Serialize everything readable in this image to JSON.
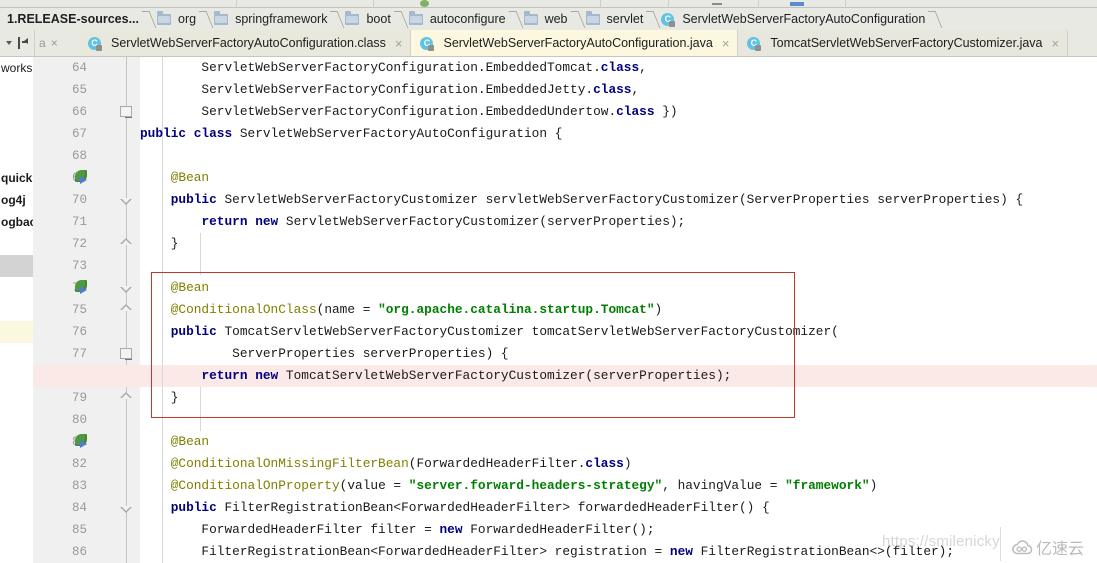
{
  "window": {
    "ide": "IntelliJ IDEA",
    "breadcrumb_separator": "›"
  },
  "breadcrumb": {
    "items": [
      {
        "label": "1.RELEASE-sources...",
        "icon": "",
        "bold": true
      },
      {
        "label": "org",
        "icon": "folder-icon",
        "bold": false
      },
      {
        "label": "springframework",
        "icon": "folder-icon",
        "bold": false
      },
      {
        "label": "boot",
        "icon": "folder-icon",
        "bold": false
      },
      {
        "label": "autoconfigure",
        "icon": "folder-icon",
        "bold": false
      },
      {
        "label": "web",
        "icon": "folder-icon",
        "bold": false
      },
      {
        "label": "servlet",
        "icon": "folder-icon",
        "bold": false
      },
      {
        "label": "ServletWebServerFactoryAutoConfiguration",
        "icon": "java-class-icon",
        "bold": false
      }
    ]
  },
  "tab_bar": {
    "nav_icons": [
      "chevron-down-icon",
      "split-editor-icon"
    ],
    "clipped_tab_label": "a",
    "tabs": [
      {
        "label": "ServletWebServerFactoryAutoConfiguration.class",
        "icon": "java-class-icon",
        "state": "selected",
        "close": "×"
      },
      {
        "label": "ServletWebServerFactoryAutoConfiguration.java",
        "icon": "java-class-icon",
        "state": "active",
        "close": "×"
      },
      {
        "label": "TomcatServletWebServerFactoryCustomizer.java",
        "icon": "java-class-icon",
        "state": "inactive",
        "close": "×"
      }
    ],
    "close_glyph": "×"
  },
  "left_panel": {
    "rows": [
      {
        "text": "worksp",
        "bold": false,
        "state": "normal"
      },
      {
        "text": "",
        "bold": false,
        "state": "normal"
      },
      {
        "text": "",
        "bold": false,
        "state": "normal"
      },
      {
        "text": "",
        "bold": false,
        "state": "normal"
      },
      {
        "text": "",
        "bold": false,
        "state": "normal"
      },
      {
        "text": "quick",
        "bold": true,
        "state": "normal"
      },
      {
        "text": "og4j",
        "bold": true,
        "state": "normal"
      },
      {
        "text": "ogbac",
        "bold": true,
        "state": "normal"
      },
      {
        "text": "",
        "bold": false,
        "state": "normal"
      },
      {
        "text": "",
        "bold": false,
        "state": "selected"
      },
      {
        "text": "",
        "bold": false,
        "state": "normal"
      },
      {
        "text": "",
        "bold": false,
        "state": "normal"
      },
      {
        "text": "",
        "bold": false,
        "state": "highlight"
      }
    ]
  },
  "editor": {
    "first_line": 64,
    "gutter_markers": [
      {
        "line": 69,
        "icon": "spring-bean-icon"
      },
      {
        "line": 74,
        "icon": "spring-bean-icon"
      },
      {
        "line": 78,
        "icon": "disabled-breakpoint-icon"
      },
      {
        "line": 81,
        "icon": "spring-bean-icon"
      }
    ],
    "highlight": {
      "block_border_color": "#c0392b",
      "executed_line_color": "#fbe9e7",
      "highlighted_line": 78,
      "block_start_line": 73,
      "block_end_line": 79
    },
    "lines": [
      {
        "n": 64,
        "indent": 0,
        "tokens": [
          {
            "t": "        ServletWebServerFactoryConfiguration.EmbeddedTomcat.",
            "c": "plain"
          },
          {
            "t": "class",
            "c": "kw"
          },
          {
            "t": ",",
            "c": "plain"
          }
        ]
      },
      {
        "n": 65,
        "indent": 0,
        "tokens": [
          {
            "t": "        ServletWebServerFactoryConfiguration.EmbeddedJetty.",
            "c": "plain"
          },
          {
            "t": "class",
            "c": "kw"
          },
          {
            "t": ",",
            "c": "plain"
          }
        ]
      },
      {
        "n": 66,
        "indent": 0,
        "tokens": [
          {
            "t": "        ServletWebServerFactoryConfiguration.EmbeddedUndertow.",
            "c": "plain"
          },
          {
            "t": "class",
            "c": "kw"
          },
          {
            "t": " })",
            "c": "plain"
          }
        ]
      },
      {
        "n": 67,
        "indent": 0,
        "tokens": [
          {
            "t": "public class",
            "c": "kw"
          },
          {
            "t": " ServletWebServerFactoryAutoConfiguration {",
            "c": "plain"
          }
        ]
      },
      {
        "n": 68,
        "indent": 0,
        "tokens": []
      },
      {
        "n": 69,
        "indent": 0,
        "tokens": [
          {
            "t": "    @Bean",
            "c": "ann"
          }
        ]
      },
      {
        "n": 70,
        "indent": 0,
        "tokens": [
          {
            "t": "    ",
            "c": "plain"
          },
          {
            "t": "public",
            "c": "kw"
          },
          {
            "t": " ServletWebServerFactoryCustomizer servletWebServerFactoryCustomizer(ServerProperties serverProperties) {",
            "c": "plain"
          }
        ]
      },
      {
        "n": 71,
        "indent": 0,
        "tokens": [
          {
            "t": "        ",
            "c": "plain"
          },
          {
            "t": "return new",
            "c": "kw"
          },
          {
            "t": " ServletWebServerFactoryCustomizer(serverProperties);",
            "c": "plain"
          }
        ]
      },
      {
        "n": 72,
        "indent": 0,
        "tokens": [
          {
            "t": "    }",
            "c": "plain"
          }
        ]
      },
      {
        "n": 73,
        "indent": 0,
        "tokens": []
      },
      {
        "n": 74,
        "indent": 0,
        "tokens": [
          {
            "t": "    @Bean",
            "c": "ann"
          }
        ]
      },
      {
        "n": 75,
        "indent": 0,
        "tokens": [
          {
            "t": "    @ConditionalOnClass",
            "c": "ann"
          },
          {
            "t": "(name = ",
            "c": "plain"
          },
          {
            "t": "\"org.apache.catalina.startup.Tomcat\"",
            "c": "str"
          },
          {
            "t": ")",
            "c": "plain"
          }
        ]
      },
      {
        "n": 76,
        "indent": 0,
        "tokens": [
          {
            "t": "    ",
            "c": "plain"
          },
          {
            "t": "public",
            "c": "kw"
          },
          {
            "t": " TomcatServletWebServerFactoryCustomizer tomcatServletWebServerFactoryCustomizer(",
            "c": "plain"
          }
        ]
      },
      {
        "n": 77,
        "indent": 0,
        "tokens": [
          {
            "t": "            ServerProperties serverProperties) {",
            "c": "plain"
          }
        ]
      },
      {
        "n": 78,
        "indent": 0,
        "tokens": [
          {
            "t": "        ",
            "c": "plain"
          },
          {
            "t": "return new",
            "c": "kw"
          },
          {
            "t": " TomcatServletWebServerFactoryCustomizer(serverProperties);",
            "c": "plain"
          }
        ]
      },
      {
        "n": 79,
        "indent": 0,
        "tokens": [
          {
            "t": "    }",
            "c": "plain"
          }
        ]
      },
      {
        "n": 80,
        "indent": 0,
        "tokens": []
      },
      {
        "n": 81,
        "indent": 0,
        "tokens": [
          {
            "t": "    @Bean",
            "c": "ann"
          }
        ]
      },
      {
        "n": 82,
        "indent": 0,
        "tokens": [
          {
            "t": "    @ConditionalOnMissingFilterBean",
            "c": "ann"
          },
          {
            "t": "(ForwardedHeaderFilter.",
            "c": "plain"
          },
          {
            "t": "class",
            "c": "kw"
          },
          {
            "t": ")",
            "c": "plain"
          }
        ]
      },
      {
        "n": 83,
        "indent": 0,
        "tokens": [
          {
            "t": "    @ConditionalOnProperty",
            "c": "ann"
          },
          {
            "t": "(value = ",
            "c": "plain"
          },
          {
            "t": "\"server.forward-headers-strategy\"",
            "c": "str"
          },
          {
            "t": ", havingValue = ",
            "c": "plain"
          },
          {
            "t": "\"framework\"",
            "c": "str"
          },
          {
            "t": ")",
            "c": "plain"
          }
        ]
      },
      {
        "n": 84,
        "indent": 0,
        "tokens": [
          {
            "t": "    ",
            "c": "plain"
          },
          {
            "t": "public",
            "c": "kw"
          },
          {
            "t": " FilterRegistrationBean<ForwardedHeaderFilter> forwardedHeaderFilter() {",
            "c": "plain"
          }
        ]
      },
      {
        "n": 85,
        "indent": 0,
        "tokens": [
          {
            "t": "        ForwardedHeaderFilter filter = ",
            "c": "plain"
          },
          {
            "t": "new",
            "c": "kw"
          },
          {
            "t": " ForwardedHeaderFilter();",
            "c": "plain"
          }
        ]
      },
      {
        "n": 86,
        "indent": 0,
        "tokens": [
          {
            "t": "        FilterRegistrationBean<ForwardedHeaderFilter> registration = ",
            "c": "plain"
          },
          {
            "t": "new",
            "c": "kw"
          },
          {
            "t": " FilterRegistrationBean<>(filter);",
            "c": "plain"
          }
        ]
      }
    ]
  },
  "watermarks": {
    "url": "https://smilenicky",
    "brand": "亿速云",
    "brand_icon": "cloud-icon"
  },
  "colors": {
    "keyword": "#000080",
    "annotation": "#808000",
    "string": "#008000",
    "gutter_bg": "#f0f0f0",
    "tab_active_bg": "#fbf8df",
    "highlight_border": "#c0392b",
    "highlight_row": "#fbe9e7"
  }
}
